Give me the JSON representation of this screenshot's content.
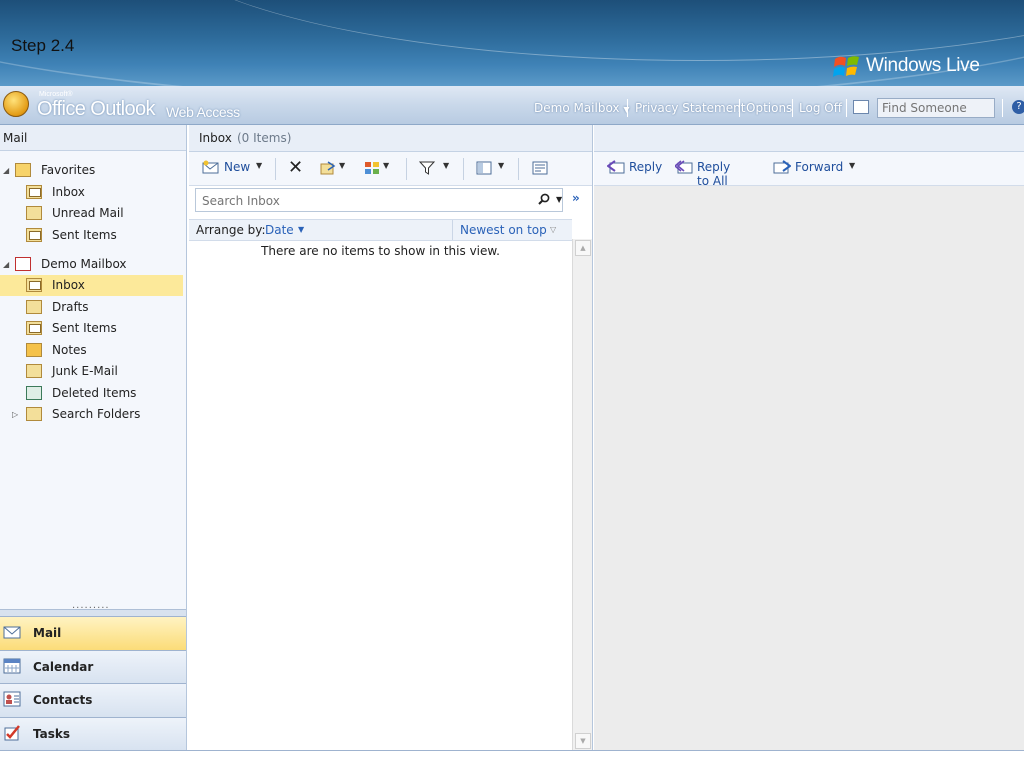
{
  "banner": {
    "step_label": "Step 2.4",
    "brand_text": "Windows Live"
  },
  "header": {
    "microsoft_label": "Microsoft®",
    "product_main": "Office Outlook",
    "product_suffix": "Web Access",
    "mailbox_link": "Demo Mailbox",
    "privacy_link": "Privacy Statement",
    "options_link": "Options",
    "logoff_link": "Log Off",
    "find_placeholder": "Find Someone",
    "help_glyph": "?"
  },
  "nav": {
    "title": "Mail",
    "favorites": {
      "label": "Favorites",
      "items": [
        {
          "label": "Inbox",
          "icon": "inbox-folder-icon"
        },
        {
          "label": "Unread Mail",
          "icon": "search-folder-icon"
        },
        {
          "label": "Sent Items",
          "icon": "sent-folder-icon"
        }
      ]
    },
    "mailbox": {
      "label": "Demo Mailbox",
      "items": [
        {
          "label": "Inbox",
          "icon": "inbox-folder-icon",
          "selected": true
        },
        {
          "label": "Drafts",
          "icon": "drafts-folder-icon"
        },
        {
          "label": "Sent Items",
          "icon": "sent-folder-icon"
        },
        {
          "label": "Notes",
          "icon": "notes-folder-icon"
        },
        {
          "label": "Junk E-Mail",
          "icon": "junk-folder-icon"
        },
        {
          "label": "Deleted Items",
          "icon": "deleted-folder-icon"
        },
        {
          "label": "Search Folders",
          "icon": "search-folder-icon"
        }
      ]
    },
    "splitter_dots": "·········",
    "buttons": [
      {
        "label": "Mail",
        "icon": "mail-icon",
        "active": true
      },
      {
        "label": "Calendar",
        "icon": "calendar-icon"
      },
      {
        "label": "Contacts",
        "icon": "contacts-icon"
      },
      {
        "label": "Tasks",
        "icon": "tasks-icon"
      }
    ]
  },
  "list": {
    "title": "Inbox",
    "count": "(0 Items)",
    "new_label": "New",
    "search_placeholder": "Search Inbox",
    "arrange_label": "Arrange by:",
    "arrange_value": "Date",
    "order_label": "Newest on top",
    "empty_message": "There are no items to show in this view."
  },
  "reading": {
    "reply_label": "Reply",
    "reply_all_label": "Reply to All",
    "forward_label": "Forward"
  },
  "colors": {
    "accent": "#2a62b8",
    "selected_bg": "#fce99a",
    "banner": "#2e6c9c"
  }
}
